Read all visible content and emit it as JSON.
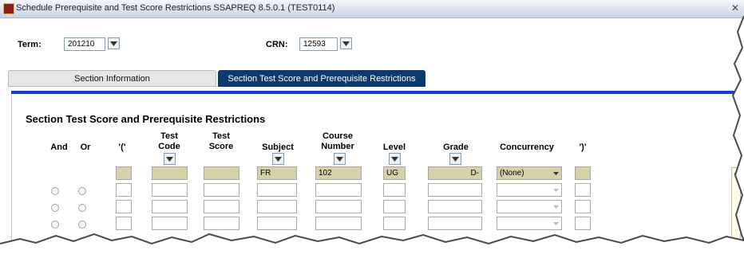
{
  "window": {
    "title": "Schedule Prerequisite and Test Score Restrictions  SSAPREQ  8.5.0.1  (TEST0114)"
  },
  "key_block": {
    "term_label": "Term:",
    "term_value": "201210",
    "crn_label": "CRN:",
    "crn_value": "12593"
  },
  "tabs": [
    {
      "label": "Section Information",
      "active": false
    },
    {
      "label": "Section Test Score and Prerequisite Restrictions",
      "active": true
    }
  ],
  "section": {
    "title": "Section Test Score and Prerequisite Restrictions",
    "columns": {
      "and": "And",
      "or": "Or",
      "lparen": "'('",
      "test_code": [
        "Test",
        "Code"
      ],
      "test_score": [
        "Test",
        "Score"
      ],
      "subject": "Subject",
      "course_number": [
        "Course",
        "Number"
      ],
      "level": "Level",
      "grade": "Grade",
      "concurrency": "Concurrency",
      "rparen": "')'"
    },
    "rows": [
      {
        "subject": "FR",
        "course_number": "102",
        "level": "UG",
        "grade": "D-",
        "concurrency": "(None)"
      },
      {
        "subject": "",
        "course_number": "",
        "level": "",
        "grade": "",
        "concurrency": ""
      },
      {
        "subject": "",
        "course_number": "",
        "level": "",
        "grade": "",
        "concurrency": ""
      },
      {
        "subject": "",
        "course_number": "",
        "level": "",
        "grade": "",
        "concurrency": ""
      }
    ]
  },
  "colors": {
    "active_tab": "#0c3a6f",
    "current_row": "#d6d1a7",
    "tab_underline": "#0a3ee8"
  }
}
